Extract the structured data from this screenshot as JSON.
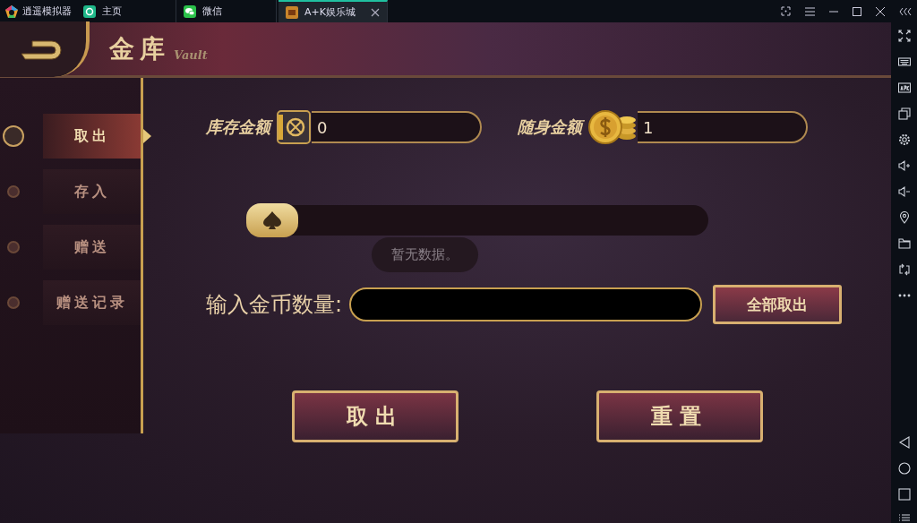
{
  "emulator": {
    "app_name": "逍遥模拟器",
    "tabs": [
      {
        "label": "主页",
        "selected": false,
        "kind": "home"
      },
      {
        "label": "微信",
        "selected": false,
        "kind": "chat"
      },
      {
        "label": "A+K娱乐城",
        "selected": true,
        "kind": "game"
      }
    ]
  },
  "header": {
    "title": "金库",
    "subtitle": "Vault"
  },
  "menu": [
    {
      "label": "取出",
      "selected": true
    },
    {
      "label": "存入",
      "selected": false
    },
    {
      "label": "赠送",
      "selected": false
    },
    {
      "label": "赠送记录",
      "selected": false
    }
  ],
  "balances": [
    {
      "label": "库存金额",
      "value": "0",
      "kind": "safe"
    },
    {
      "label": "随身金额",
      "value": "1",
      "kind": "coins"
    }
  ],
  "slider": {
    "level": 0
  },
  "toast": "暂无数据。",
  "amount_label": "输入金币数量:",
  "withdraw_all_button": "全部取出",
  "buttons": [
    "取出",
    "重置"
  ]
}
